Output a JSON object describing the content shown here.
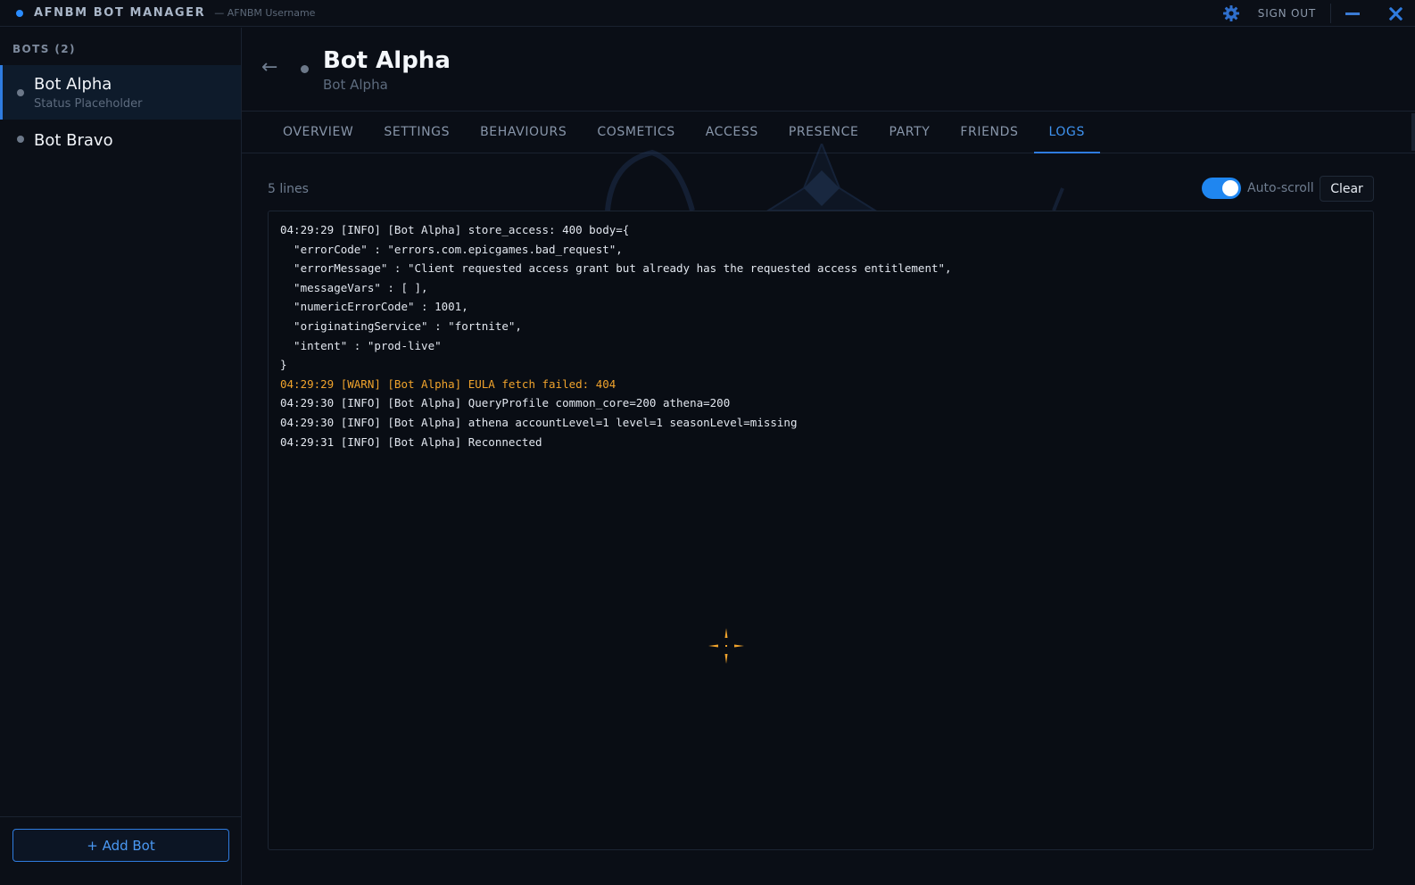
{
  "titlebar": {
    "app_title": "AFNBM BOT MANAGER",
    "app_subtitle": "— AFNBM Username",
    "signout_label": "SIGN OUT",
    "icons": [
      "gear-icon",
      "minimize-icon",
      "close-icon"
    ]
  },
  "sidebar": {
    "heading": "BOTS (2)",
    "bots": [
      {
        "name": "Bot Alpha",
        "status": "Status Placeholder"
      },
      {
        "name": "Bot Bravo",
        "status": ""
      }
    ],
    "add_bot_label": "+ Add Bot"
  },
  "header": {
    "back_glyph": "←",
    "title": "Bot Alpha",
    "subtitle": "Bot Alpha"
  },
  "tabs": [
    "OVERVIEW",
    "SETTINGS",
    "BEHAVIOURS",
    "COSMETICS",
    "ACCESS",
    "PRESENCE",
    "PARTY",
    "FRIENDS",
    "LOGS"
  ],
  "active_tab": "LOGS",
  "logs": {
    "line_count_label": "5 lines",
    "autoscroll_label": "Auto-scroll",
    "autoscroll_on": true,
    "clear_label": "Clear",
    "lines": [
      {
        "text": "04:29:29 [INFO] [Bot Alpha] store_access: 400 body={",
        "level": "info"
      },
      {
        "text": "  \"errorCode\" : \"errors.com.epicgames.bad_request\",",
        "level": "info"
      },
      {
        "text": "  \"errorMessage\" : \"Client requested access grant but already has the requested access entitlement\",",
        "level": "info"
      },
      {
        "text": "  \"messageVars\" : [ ],",
        "level": "info"
      },
      {
        "text": "  \"numericErrorCode\" : 1001,",
        "level": "info"
      },
      {
        "text": "  \"originatingService\" : \"fortnite\",",
        "level": "info"
      },
      {
        "text": "  \"intent\" : \"prod-live\"",
        "level": "info"
      },
      {
        "text": "}",
        "level": "info"
      },
      {
        "text": "04:29:29 [WARN] [Bot Alpha] EULA fetch failed: 404",
        "level": "warn"
      },
      {
        "text": "04:29:30 [INFO] [Bot Alpha] QueryProfile common_core=200 athena=200",
        "level": "info"
      },
      {
        "text": "04:29:30 [INFO] [Bot Alpha] athena accountLevel=1 level=1 seasonLevel=missing",
        "level": "info"
      },
      {
        "text": "04:29:31 [INFO] [Bot Alpha] Reconnected",
        "level": "info"
      }
    ]
  },
  "colors": {
    "accent": "#2f7ce0",
    "active_tab": "#3f93f0",
    "warn": "#f0a32c",
    "background": "#0a0e16"
  }
}
